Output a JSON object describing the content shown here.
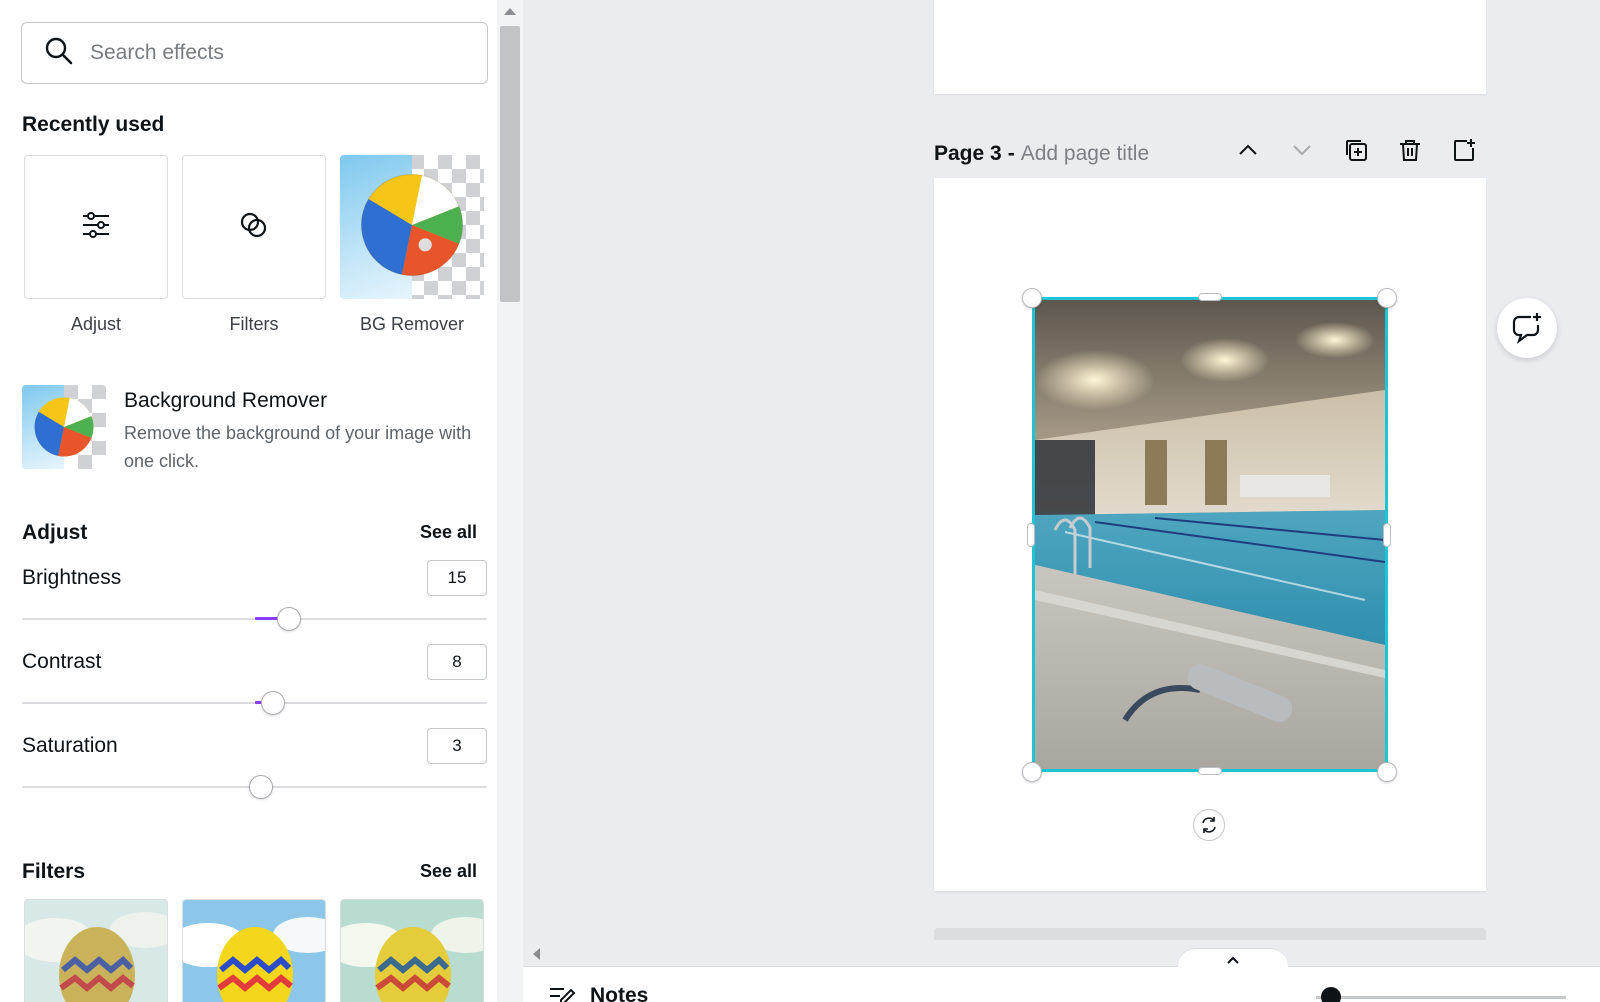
{
  "search": {
    "placeholder": "Search effects"
  },
  "recently_used": {
    "title": "Recently used",
    "items": [
      {
        "label": "Adjust",
        "icon": "sliders-icon"
      },
      {
        "label": "Filters",
        "icon": "filters-icon"
      },
      {
        "label": "BG Remover",
        "icon": "beach-ball-icon"
      }
    ]
  },
  "bg_remover": {
    "title": "Background Remover",
    "description": "Remove the background of your image with one click."
  },
  "adjust": {
    "title": "Adjust",
    "see_all": "See all",
    "controls": [
      {
        "label": "Brightness",
        "value": "15",
        "level": 15,
        "min": -100,
        "max": 100
      },
      {
        "label": "Contrast",
        "value": "8",
        "level": 8,
        "min": -100,
        "max": 100
      },
      {
        "label": "Saturation",
        "value": "3",
        "level": 3,
        "min": -100,
        "max": 100
      }
    ]
  },
  "filters": {
    "title": "Filters",
    "see_all": "See all"
  },
  "page": {
    "prefix": "Page 3",
    "separator": "-",
    "title_placeholder": "Add page title"
  },
  "bottom": {
    "notes_label": "Notes"
  },
  "colors": {
    "selection": "#1ec4d3",
    "slider_fill": "#8b3dff",
    "canvas_bg": "#ebecf0"
  }
}
